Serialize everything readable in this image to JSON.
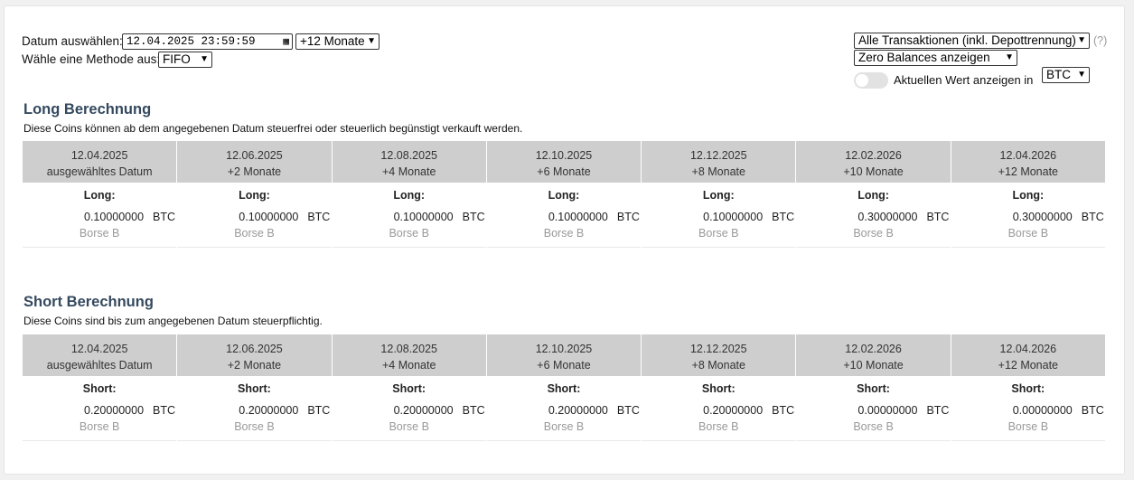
{
  "controls": {
    "date_label": "Datum auswählen:",
    "date_value": "12.04.2025 23:59:59",
    "range_select": "+12 Monate",
    "method_label": "Wähle eine Methode aus:",
    "method_select": "FIFO",
    "transactions_select": "Alle Transaktionen (inkl. Depottrennung)",
    "help_text": "(?)",
    "balances_select": "Zero Balances anzeigen",
    "current_value_label": "Aktuellen Wert anzeigen in",
    "currency_select": "BTC"
  },
  "columns": [
    {
      "date": "12.04.2025",
      "sub": "ausgewähltes Datum"
    },
    {
      "date": "12.06.2025",
      "sub": "+2 Monate"
    },
    {
      "date": "12.08.2025",
      "sub": "+4 Monate"
    },
    {
      "date": "12.10.2025",
      "sub": "+6 Monate"
    },
    {
      "date": "12.12.2025",
      "sub": "+8 Monate"
    },
    {
      "date": "12.02.2026",
      "sub": "+10 Monate"
    },
    {
      "date": "12.04.2026",
      "sub": "+12 Monate"
    }
  ],
  "long": {
    "title": "Long Berechnung",
    "description": "Diese Coins können ab dem angegebenen Datum steuerfrei oder steuerlich begünstigt verkauft werden.",
    "label": "Long:",
    "unit": "BTC",
    "exchange": "Borse B",
    "values": [
      "0.10000000",
      "0.10000000",
      "0.10000000",
      "0.10000000",
      "0.10000000",
      "0.30000000",
      "0.30000000"
    ]
  },
  "short": {
    "title": "Short Berechnung",
    "description": "Diese Coins sind bis zum angegebenen Datum steuerpflichtig.",
    "label": "Short:",
    "unit": "BTC",
    "exchange": "Borse B",
    "values": [
      "0.20000000",
      "0.20000000",
      "0.20000000",
      "0.20000000",
      "0.20000000",
      "0.00000000",
      "0.00000000"
    ]
  }
}
